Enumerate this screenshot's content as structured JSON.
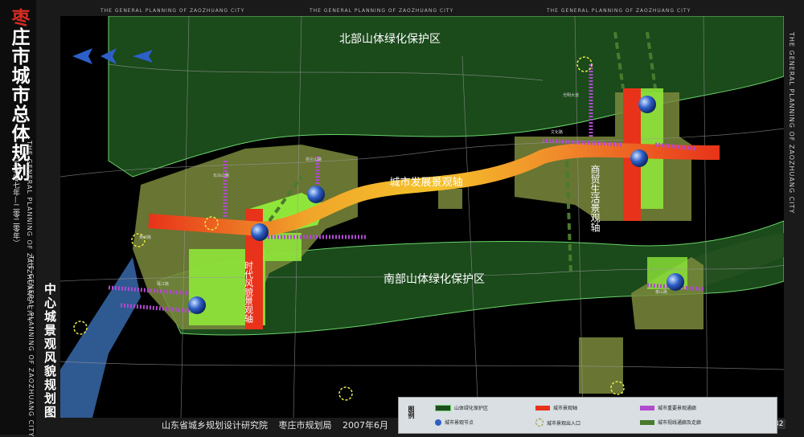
{
  "sidebar": {
    "title_first": "枣",
    "title_rest": "庄市城市总体规划",
    "period": "（二零零七年—二零二零年）",
    "english": "THE GENERAL PLANNING OF ZAOZHUANG CITY",
    "map_title": "中心城景观风貌规划图",
    "map_english": "THE GENERAL PLANNING OF ZAOZHUANG CITY"
  },
  "header": {
    "english_repeat": "THE GENERAL PLANNING OF ZAOZHUANG CITY"
  },
  "map": {
    "north_zone": "北部山体绿化保护区",
    "south_zone": "南部山体绿化保护区",
    "axis_main": "城市发展景观轴",
    "axis_commerce": "商贸生活景观轴",
    "axis_era": "时代风貌景观轴",
    "road_labels": [
      "文化路",
      "黄河路",
      "珠江路",
      "长白山路",
      "昆仑山路",
      "光明大道",
      "泰山路"
    ]
  },
  "legend": {
    "title": "图例",
    "items": [
      {
        "label": "山体绿化保护区",
        "color": "#1f4d1f"
      },
      {
        "label": "城市景观轴",
        "color": "#e8331a"
      },
      {
        "label": "城市重要景观通廊",
        "color": "#b04ad0"
      },
      {
        "label": "城市景观节点",
        "color": "#2d5fc7"
      },
      {
        "label": "城市景观出入口",
        "color": "#e8e84a"
      },
      {
        "label": "城市视线通廊及走廊",
        "color": "#4a7a2e"
      }
    ]
  },
  "footer": {
    "institute": "山东省城乡规划设计研究院",
    "bureau": "枣庄市规划局",
    "date": "2007年6月",
    "page": "32"
  },
  "colors": {
    "background": "#000000",
    "urban": "#7a8a3c",
    "green_zone": "#1b4a1b",
    "core_green": "#8fe63a",
    "axis_red": "#e8331a",
    "axis_yellow": "#f5c22a"
  }
}
